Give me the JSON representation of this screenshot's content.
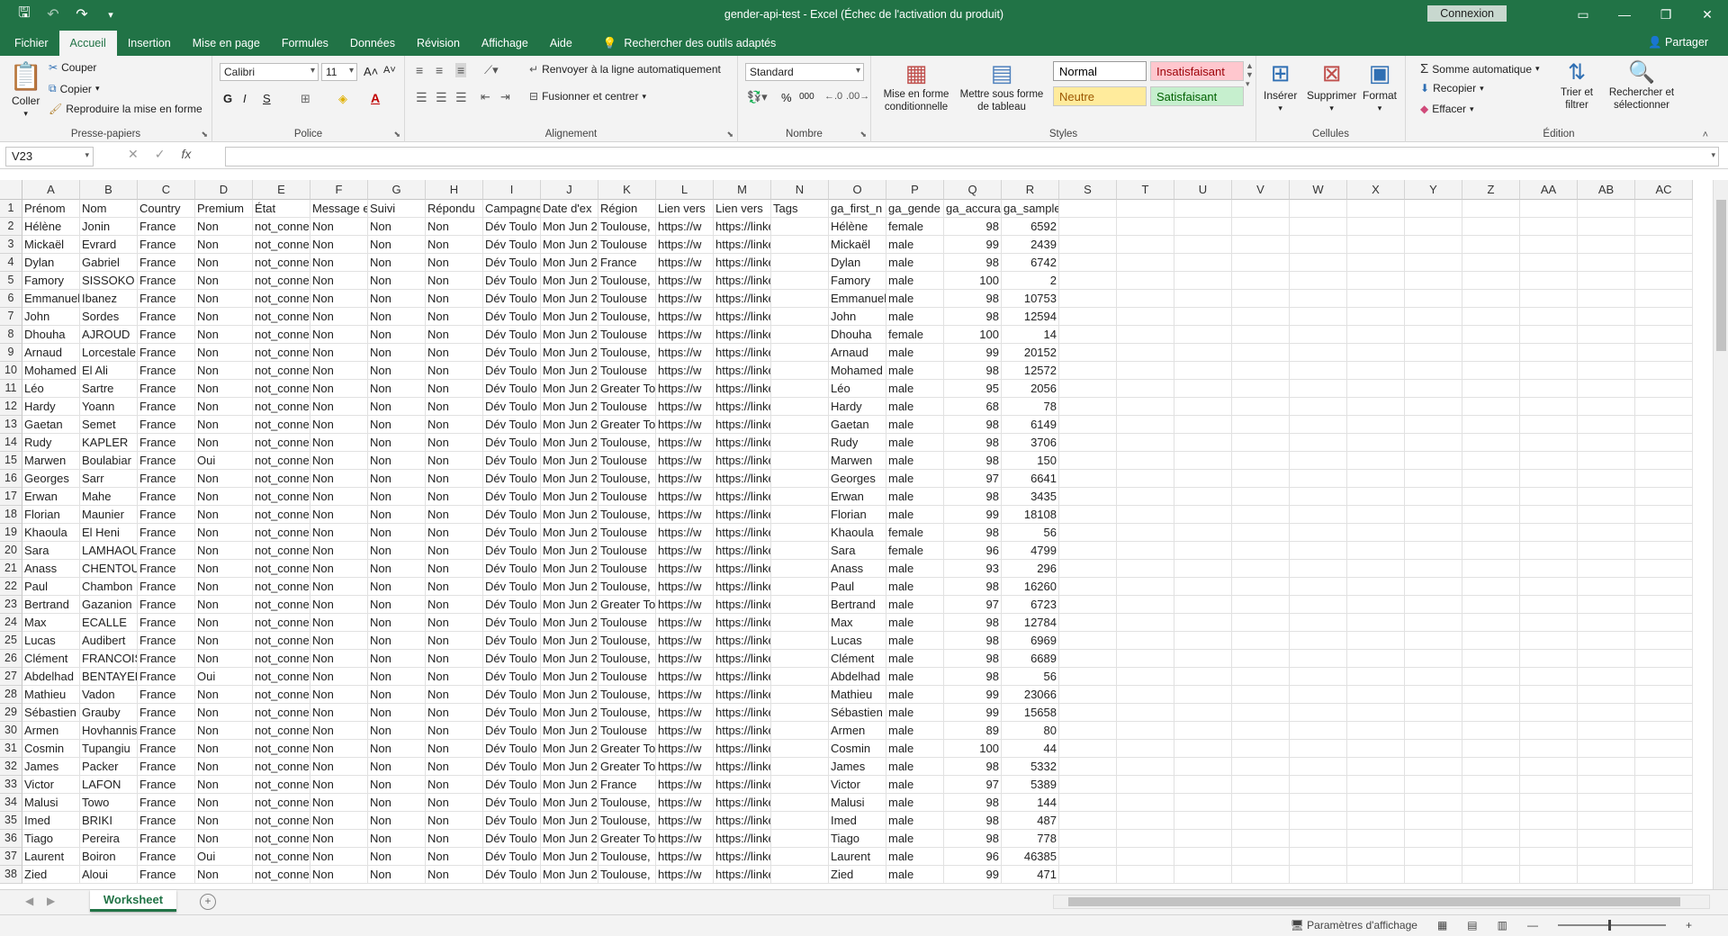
{
  "titlebar": {
    "title": "gender-api-test  -  Excel (Échec de l'activation du produit)",
    "connexion": "Connexion"
  },
  "tabs": [
    "Fichier",
    "Accueil",
    "Insertion",
    "Mise en page",
    "Formules",
    "Données",
    "Révision",
    "Affichage",
    "Aide"
  ],
  "tell_me": "Rechercher des outils adaptés",
  "share": "Partager",
  "ribbon": {
    "clipboard": {
      "label": "Presse-papiers",
      "paste": "Coller",
      "cut": "Couper",
      "copy": "Copier",
      "format_painter": "Reproduire la mise en forme"
    },
    "font": {
      "label": "Police",
      "name": "Calibri",
      "size": "11",
      "bold": "G",
      "italic": "I",
      "underline": "S"
    },
    "alignment": {
      "label": "Alignement",
      "wrap": "Renvoyer à la ligne automatiquement",
      "merge": "Fusionner et centrer"
    },
    "number": {
      "label": "Nombre",
      "format": "Standard",
      "percent": "%",
      "thousands": "000"
    },
    "styles": {
      "label": "Styles",
      "cond_format": "Mise en forme conditionnelle",
      "table_format": "Mettre sous forme de tableau",
      "normal": "Normal",
      "bad": "Insatisfaisant",
      "neutral": "Neutre",
      "good": "Satisfaisant"
    },
    "cells": {
      "label": "Cellules",
      "insert": "Insérer",
      "delete": "Supprimer",
      "format": "Format"
    },
    "editing": {
      "label": "Édition",
      "autosum": "Somme automatique",
      "fill": "Recopier",
      "clear": "Effacer",
      "sort": "Trier et filtrer",
      "find": "Rechercher et sélectionner"
    }
  },
  "formula_bar": {
    "name_box": "V23",
    "fx": "fx",
    "value": ""
  },
  "columns": [
    "A",
    "B",
    "C",
    "D",
    "E",
    "F",
    "G",
    "H",
    "I",
    "J",
    "K",
    "L",
    "M",
    "N",
    "O",
    "P",
    "Q",
    "R",
    "S",
    "T",
    "U",
    "V",
    "W",
    "X",
    "Y",
    "Z",
    "AA",
    "AB",
    "AC"
  ],
  "headers": [
    "Prénom",
    "Nom",
    "Country",
    "Premium",
    "État",
    "Message e",
    "Suivi",
    "Répondu",
    "Campagne",
    "Date d'ex",
    "Région",
    "Lien vers",
    "Lien vers",
    "Tags",
    "ga_first_n",
    "ga_gende",
    "ga_accura",
    "ga_samples"
  ],
  "rows": [
    [
      "Hélène",
      "Jonin",
      "female",
      "98",
      "6592",
      "Toulouse,"
    ],
    [
      "Mickaël",
      "Evrard",
      "male",
      "99",
      "2439",
      "Toulouse"
    ],
    [
      "Dylan",
      "Gabriel",
      "male",
      "98",
      "6742",
      "France"
    ],
    [
      "Famory",
      "SISSOKO",
      "male",
      "100",
      "2",
      "Toulouse,"
    ],
    [
      "Emmanuel",
      "Ibanez",
      "male",
      "98",
      "10753",
      "Toulouse"
    ],
    [
      "John",
      "Sordes",
      "male",
      "98",
      "12594",
      "Toulouse,"
    ],
    [
      "Dhouha",
      "AJROUD",
      "female",
      "100",
      "14",
      "Toulouse"
    ],
    [
      "Arnaud",
      "Lorcestale",
      "male",
      "99",
      "20152",
      "Toulouse,"
    ],
    [
      "Mohamed",
      "El Ali",
      "male",
      "98",
      "12572",
      "Toulouse"
    ],
    [
      "Léo",
      "Sartre",
      "male",
      "95",
      "2056",
      "Greater To"
    ],
    [
      "Hardy",
      "Yoann",
      "male",
      "68",
      "78",
      "Toulouse"
    ],
    [
      "Gaetan",
      "Semet",
      "male",
      "98",
      "6149",
      "Greater To"
    ],
    [
      "Rudy",
      "KAPLER",
      "male",
      "98",
      "3706",
      "Toulouse,"
    ],
    [
      "Marwen",
      "Boulabiar",
      "male",
      "98",
      "150",
      "Toulouse"
    ],
    [
      "Georges",
      "Sarr",
      "male",
      "97",
      "6641",
      "Toulouse,"
    ],
    [
      "Erwan",
      "Mahe",
      "male",
      "98",
      "3435",
      "Toulouse"
    ],
    [
      "Florian",
      "Maunier",
      "male",
      "99",
      "18108",
      "Toulouse,"
    ],
    [
      "Khaoula",
      "El Heni",
      "female",
      "98",
      "56",
      "Toulouse"
    ],
    [
      "Sara",
      "LAMHAOU",
      "female",
      "96",
      "4799",
      "Toulouse"
    ],
    [
      "Anass",
      "CHENTOU",
      "male",
      "93",
      "296",
      "Toulouse"
    ],
    [
      "Paul",
      "Chambon",
      "male",
      "98",
      "16260",
      "Toulouse,"
    ],
    [
      "Bertrand",
      "Gazanion",
      "male",
      "97",
      "6723",
      "Greater To"
    ],
    [
      "Max",
      "ECALLE",
      "male",
      "98",
      "12784",
      "Toulouse"
    ],
    [
      "Lucas",
      "Audibert",
      "male",
      "98",
      "6969",
      "Toulouse,"
    ],
    [
      "Clément",
      "FRANCOIS",
      "male",
      "98",
      "6689",
      "Toulouse,"
    ],
    [
      "Abdelhad",
      "BENTAYEB",
      "male",
      "98",
      "56",
      "Toulouse"
    ],
    [
      "Mathieu",
      "Vadon",
      "male",
      "99",
      "23066",
      "Toulouse,"
    ],
    [
      "Sébastien",
      "Grauby",
      "male",
      "99",
      "15658",
      "Toulouse,"
    ],
    [
      "Armen",
      "Hovhanniss",
      "male",
      "89",
      "80",
      "Toulouse"
    ],
    [
      "Cosmin",
      "Tupangiu",
      "male",
      "100",
      "44",
      "Greater To"
    ],
    [
      "James",
      "Packer",
      "male",
      "98",
      "5332",
      "Greater To"
    ],
    [
      "Victor",
      "LAFON",
      "male",
      "97",
      "5389",
      "France"
    ],
    [
      "Malusi",
      "Towo",
      "male",
      "98",
      "144",
      "Toulouse,"
    ],
    [
      "Imed",
      "BRIKI",
      "male",
      "98",
      "487",
      "Toulouse,"
    ],
    [
      "Tiago",
      "Pereira",
      "male",
      "98",
      "778",
      "Greater To"
    ],
    [
      "Laurent",
      "Boiron",
      "male",
      "96",
      "46385",
      "Toulouse,"
    ],
    [
      "Zied",
      "Aloui",
      "male",
      "99",
      "471",
      "Toulouse,"
    ]
  ],
  "premium_oui_rows": [
    15,
    27,
    37
  ],
  "constants": {
    "country": "France",
    "premium_no": "Non",
    "premium_yes": "Oui",
    "state": "not_conne",
    "message": "Non",
    "suivi": "Non",
    "repondu": "Non",
    "campagne": "Dév Toulo",
    "date": "Mon Jun 2",
    "lien1": "https://w",
    "lien2": "https://linkedin.com"
  },
  "sheet": {
    "name": "Worksheet",
    "display_settings": "Paramètres d'affichage"
  }
}
